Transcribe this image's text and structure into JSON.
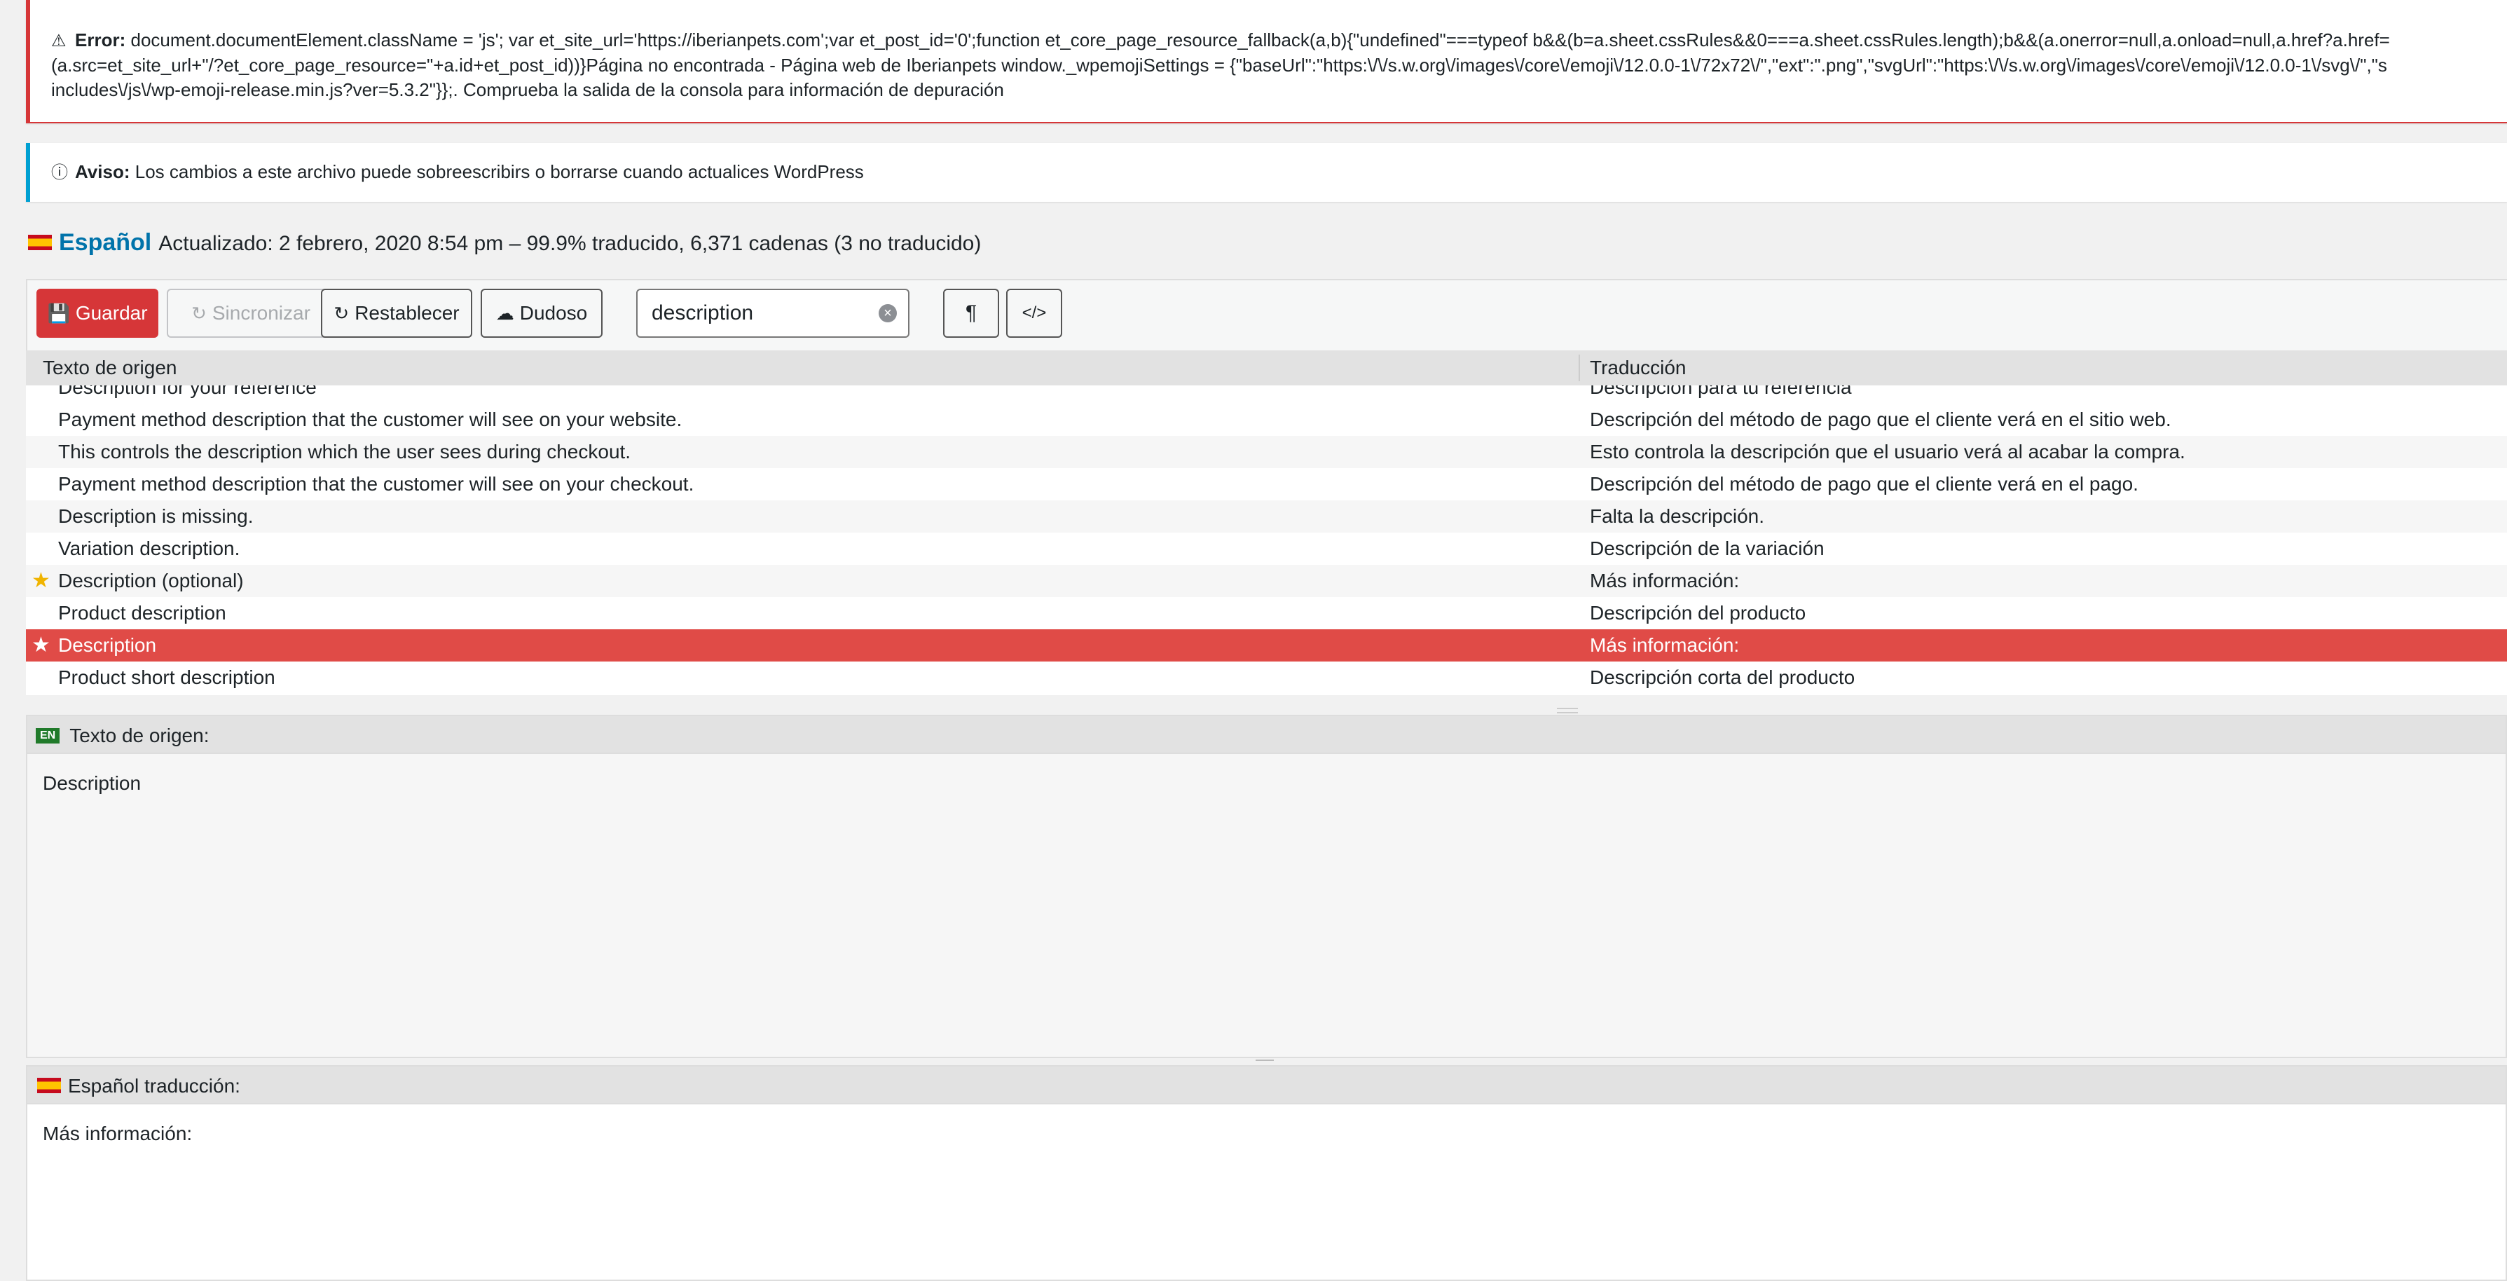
{
  "error_notice": {
    "icon": "warning-icon",
    "label": "Error:",
    "line1": "document.documentElement.className = 'js'; var et_site_url='https://iberianpets.com';var et_post_id='0';function et_core_page_resource_fallback(a,b){\"undefined\"===typeof b&&(b=a.sheet.cssRules&&0===a.sheet.cssRules.length);b&&(a.onerror=null,a.onload=null,a.href?a.href=",
    "line2": "(a.src=et_site_url+\"/?et_core_page_resource=\"+a.id+et_post_id))}Página no encontrada - Página web de Iberianpets window._wpemojiSettings = {\"baseUrl\":\"https:\\/\\/s.w.org\\/images\\/core\\/emoji\\/12.0.0-1\\/72x72\\/\",\"ext\":\".png\",\"svgUrl\":\"https:\\/\\/s.w.org\\/images\\/core\\/emoji\\/12.0.0-1\\/svg\\/\",\"s",
    "line3": "includes\\/js\\/wp-emoji-release.min.js?ver=5.3.2\"}};. Comprueba la salida de la consola para información de depuración"
  },
  "info_notice": {
    "icon": "info-icon",
    "label": "Aviso:",
    "text": "Los cambios a este archivo puede sobreescribirs o borrarse cuando actualices WordPress"
  },
  "locale": {
    "name": "Español",
    "status": "Actualizado: 2 febrero, 2020 8:54 pm – 99.9% traducido, 6,371 cadenas (3 no traducido)"
  },
  "toolbar": {
    "save_label": "Guardar",
    "sync_label": "Sincronizar",
    "revert_label": "Restablecer",
    "fuzzy_label": "Dudoso",
    "search_value": "description",
    "para_label": "¶",
    "code_label": "</>"
  },
  "list": {
    "col_source": "Texto de origen",
    "col_translation": "Traducción",
    "rows": [
      {
        "source": "Description for your reference",
        "translation": "Descripción para tu referencia",
        "starred": false,
        "selected": false
      },
      {
        "source": "Payment method description that the customer will see on your website.",
        "translation": "Descripción del método de pago que el cliente verá en el sitio web.",
        "starred": false,
        "selected": false
      },
      {
        "source": "This controls the description which the user sees during checkout.",
        "translation": "Esto controla la descripción que el usuario verá al acabar la compra.",
        "starred": false,
        "selected": false
      },
      {
        "source": "Payment method description that the customer will see on your checkout.",
        "translation": "Descripción del método de pago que el cliente verá en el pago.",
        "starred": false,
        "selected": false
      },
      {
        "source": "Description is missing.",
        "translation": "Falta la descripción.",
        "starred": false,
        "selected": false
      },
      {
        "source": "Variation description.",
        "translation": "Descripción de la variación",
        "starred": false,
        "selected": false
      },
      {
        "source": "Description (optional)",
        "translation": "Más información:",
        "starred": true,
        "selected": false
      },
      {
        "source": "Product description",
        "translation": "Descripción del producto",
        "starred": false,
        "selected": false
      },
      {
        "source": "Description",
        "translation": "Más información:",
        "starred": true,
        "selected": true
      },
      {
        "source": "Product short description",
        "translation": "Descripción corta del producto",
        "starred": false,
        "selected": false
      }
    ]
  },
  "source_panel": {
    "lang_tag": "EN",
    "title": "Texto de origen:",
    "text": "Description"
  },
  "translation_panel": {
    "title": "Español traducción:",
    "text": "Más información:"
  }
}
